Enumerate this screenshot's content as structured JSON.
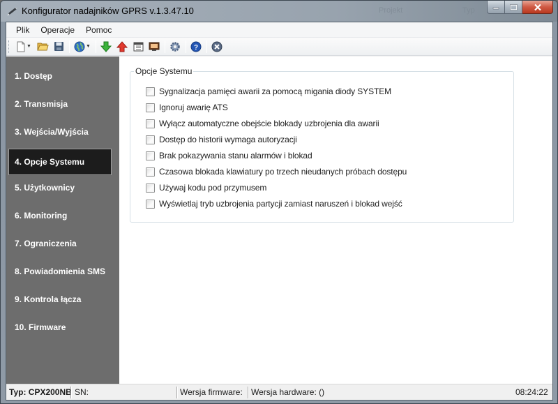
{
  "window": {
    "title": "Konfigurator nadajników GPRS v.1.3.47.10",
    "background_text": [
      "Projekt",
      "Typ"
    ],
    "controls": {
      "minimize": "minimize-icon",
      "maximize": "maximize-icon",
      "close": "close-icon"
    }
  },
  "menu": [
    "Plik",
    "Operacje",
    "Pomoc"
  ],
  "toolbar": {
    "icons": [
      "new-document-icon",
      "open-folder-icon",
      "save-icon",
      "globe-icon",
      "download-arrow-icon",
      "upload-arrow-icon",
      "calendar-icon",
      "monitor-icon",
      "settings-gear-icon",
      "help-icon",
      "exit-icon"
    ]
  },
  "sidebar": {
    "items": [
      {
        "label": "1. Dostęp"
      },
      {
        "label": "2. Transmisja"
      },
      {
        "label": "3. Wejścia/Wyjścia"
      },
      {
        "label": "4. Opcje Systemu",
        "active": true
      },
      {
        "label": "5. Użytkownicy"
      },
      {
        "label": "6. Monitoring"
      },
      {
        "label": "7. Ograniczenia"
      },
      {
        "label": "8. Powiadomienia SMS"
      },
      {
        "label": "9. Kontrola łącza"
      },
      {
        "label": "10. Firmware"
      }
    ]
  },
  "main": {
    "group_title": "Opcje Systemu",
    "options": [
      {
        "label": "Sygnalizacja pamięci awarii za pomocą migania diody SYSTEM",
        "checked": false
      },
      {
        "label": "Ignoruj awarię ATS",
        "checked": false
      },
      {
        "label": "Wyłącz automatyczne obejście blokady uzbrojenia dla awarii",
        "checked": false
      },
      {
        "label": "Dostęp do historii wymaga autoryzacji",
        "checked": false
      },
      {
        "label": "Brak pokazywania stanu alarmów i blokad",
        "checked": false
      },
      {
        "label": "Czasowa blokada klawiatury po trzech nieudanych próbach dostępu",
        "checked": false
      },
      {
        "label": "Używaj kodu pod przymusem",
        "checked": false
      },
      {
        "label": "Wyświetlaj tryb uzbrojenia partycji zamiast naruszeń i blokad wejść",
        "checked": false
      }
    ]
  },
  "status": {
    "type": "Typ: CPX200NB",
    "sn": "SN:",
    "firmware": "Wersja firmware:",
    "hardware": "Wersja hardware: ()",
    "time": "08:24:22"
  },
  "colors": {
    "sidebar_bg": "#6d6d6d",
    "sidebar_active_bg": "#1c1c1c",
    "close_button": "#c9503a"
  }
}
